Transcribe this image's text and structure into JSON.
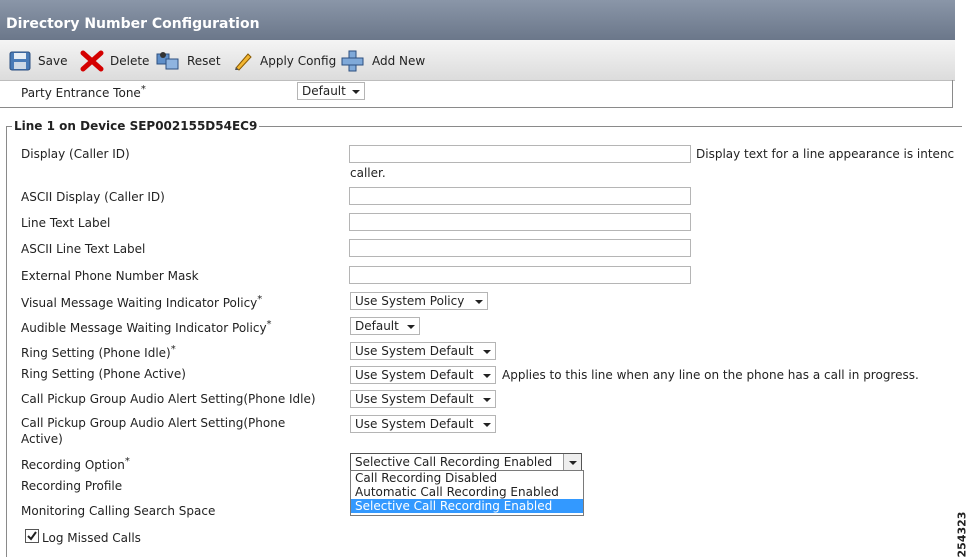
{
  "window": {
    "title": "Directory Number Configuration"
  },
  "toolbar": {
    "save": "Save",
    "delete": "Delete",
    "reset": "Reset",
    "apply_config": "Apply Config",
    "add_new": "Add New"
  },
  "party_entrance": {
    "label": "Party Entrance Tone",
    "required": "*",
    "value": "Default"
  },
  "section": {
    "legend": "Line 1 on Device SEP002155D54EC9"
  },
  "fields": {
    "display_caller_id": {
      "label": "Display (Caller ID)",
      "hint": "Display text for a line appearance is intenc",
      "hint2": "caller."
    },
    "ascii_display": {
      "label": "ASCII Display (Caller ID)"
    },
    "line_text_label": {
      "label": "Line Text Label"
    },
    "ascii_line_text_label": {
      "label": "ASCII Line Text Label"
    },
    "external_mask": {
      "label": "External Phone Number Mask"
    },
    "visual_mwi": {
      "label": "Visual Message Waiting Indicator Policy",
      "required": "*",
      "value": "Use System Policy"
    },
    "audible_mwi": {
      "label": "Audible Message Waiting Indicator Policy",
      "required": "*",
      "value": "Default"
    },
    "ring_idle": {
      "label": "Ring Setting (Phone Idle)",
      "required": "*",
      "value": "Use System Default"
    },
    "ring_active": {
      "label": "Ring Setting (Phone Active)",
      "value": "Use System Default",
      "hint": "Applies to this line when any line on the phone has a call in progress."
    },
    "pickup_idle": {
      "label": "Call Pickup Group Audio Alert Setting(Phone Idle)",
      "value": "Use System Default"
    },
    "pickup_active": {
      "label1": "Call Pickup Group Audio Alert Setting(Phone",
      "label2": "Active)",
      "value": "Use System Default"
    },
    "recording_option": {
      "label": "Recording Option",
      "required": "*",
      "value": "Selective Call Recording Enabled"
    },
    "recording_profile": {
      "label": "Recording Profile"
    },
    "monitoring_css": {
      "label": "Monitoring Calling Search Space"
    },
    "log_missed": {
      "label": "Log Missed Calls",
      "checked": true
    }
  },
  "recording_dropdown": {
    "options": [
      "Call Recording Disabled",
      "Automatic Call Recording Enabled",
      "Selective Call Recording Enabled"
    ],
    "selected_index": 2
  },
  "figure_id": "254323",
  "colors": {
    "title_bar": "#7b8799",
    "selected_option": "#3399ff",
    "delete_icon": "#d40000"
  }
}
